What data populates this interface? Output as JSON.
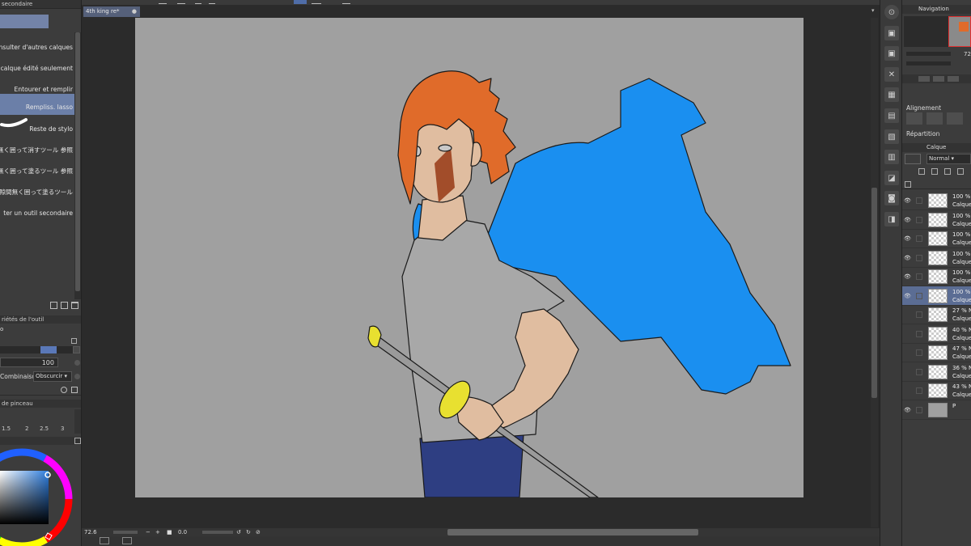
{
  "document": {
    "tab_title": "4th king re*",
    "zoom": "72.6",
    "rotation": "0.0"
  },
  "left_panel": {
    "subtool_header": "secondaire",
    "subtools": [
      {
        "label": "Consulter d'autres calques",
        "selected": false
      },
      {
        "label": "r le calque édité seulement",
        "selected": false
      },
      {
        "label": "Entourer et remplir",
        "selected": false
      },
      {
        "label": "Rempliss. lasso",
        "selected": true
      },
      {
        "label": "Reste de stylo",
        "selected": false
      },
      {
        "label": "無く囲って消すツール 参照",
        "selected": false
      },
      {
        "label": "無く囲って塗るツール 参照",
        "selected": false
      },
      {
        "label": "隙間無く囲って塗るツール",
        "selected": false
      },
      {
        "label": "ter un outil secondaire",
        "selected": false
      }
    ],
    "tool_property_header": "riétés de l'outil",
    "tool_property_name": "o",
    "opacity_value": "100",
    "combine_label": "Combinaison",
    "combine_value": "Obscurcir",
    "brush_size_header": "de pinceau",
    "brush_sizes": [
      "1.5",
      "2",
      "2.5",
      "3"
    ]
  },
  "right_panel": {
    "navigator_title": "Navigation",
    "nav_zoom": "72",
    "align_label": "Alignement",
    "distribute_label": "Répartition",
    "layer_tab_label": "Calque",
    "blend_mode": "Normal",
    "layers": [
      {
        "opacity": "100 %",
        "name": "Calque",
        "visible": true,
        "selected": false
      },
      {
        "opacity": "100 %",
        "name": "Calque",
        "visible": true,
        "selected": false
      },
      {
        "opacity": "100 %",
        "name": "Calque",
        "visible": true,
        "selected": false
      },
      {
        "opacity": "100 %",
        "name": "Calque",
        "visible": true,
        "selected": false
      },
      {
        "opacity": "100 %",
        "name": "Calque",
        "visible": true,
        "selected": false
      },
      {
        "opacity": "100 %",
        "name": "Calque",
        "visible": true,
        "selected": true
      },
      {
        "opacity": "27 % N",
        "name": "Calque",
        "visible": false,
        "selected": false
      },
      {
        "opacity": "40 % N",
        "name": "Calque",
        "visible": false,
        "selected": false
      },
      {
        "opacity": "47 % N",
        "name": "Calque",
        "visible": false,
        "selected": false
      },
      {
        "opacity": "36 % N",
        "name": "Calque",
        "visible": false,
        "selected": false
      },
      {
        "opacity": "43 % N",
        "name": "Calque",
        "visible": false,
        "selected": false
      },
      {
        "opacity": "",
        "name": "P",
        "visible": true,
        "selected": false
      }
    ]
  },
  "colors": {
    "accent": "#6b7fa8",
    "canvas_bg": "#a0a0a0",
    "hair": "#e06b2a",
    "cape": "#1a8ff0",
    "shirt": "#a8a8a8",
    "skin": "#e0bda0",
    "pants": "#2e3e82",
    "sword_guard": "#e8e030"
  }
}
